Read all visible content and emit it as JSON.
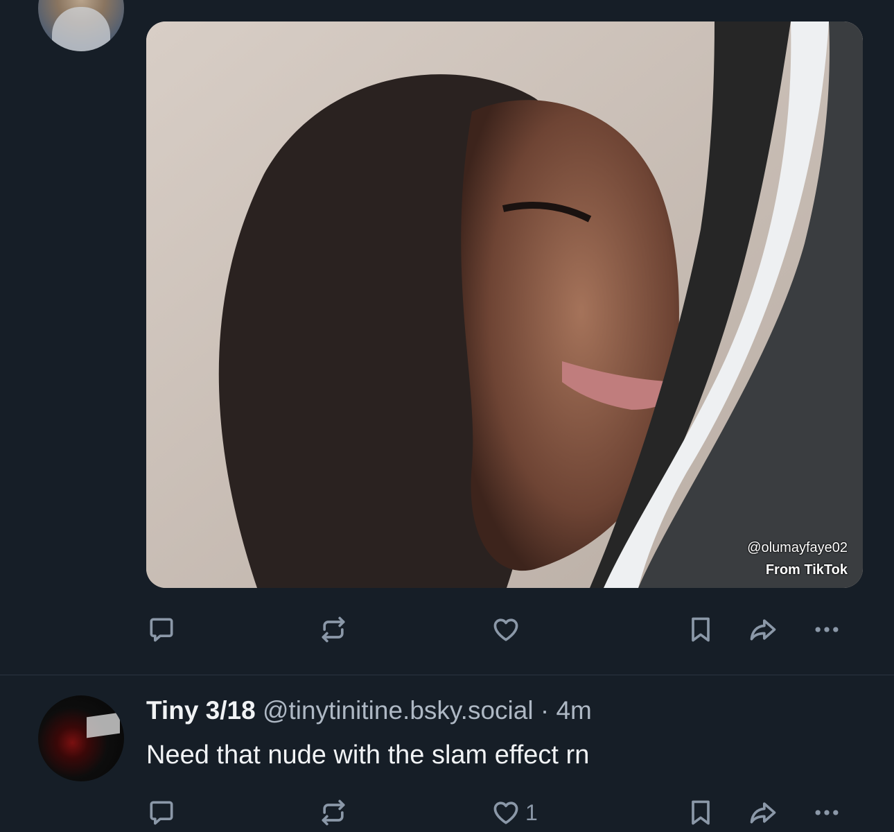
{
  "post": {
    "media": {
      "description_icon": "photo",
      "watermark_handle": "@olumayfaye02",
      "watermark_source": "From TikTok"
    },
    "actions": {
      "reply_count": "",
      "repost_count": "",
      "like_count": ""
    }
  },
  "reply": {
    "author_name": "Tiny 3/18",
    "author_handle": "@tinytinitine.bsky.social",
    "separator": "·",
    "timestamp": "4m",
    "text": "Need that nude with the slam effect rn",
    "actions": {
      "reply_count": "",
      "repost_count": "",
      "like_count": "1"
    }
  },
  "icons": [
    "reply-icon",
    "repost-icon",
    "like-icon",
    "bookmark-icon",
    "share-icon",
    "more-icon"
  ],
  "colors": {
    "background": "#161e27",
    "icon_gray": "#8b98a8",
    "text_primary": "#f1f3f5",
    "text_secondary": "#aeb8c4",
    "divider": "#2a3441"
  }
}
